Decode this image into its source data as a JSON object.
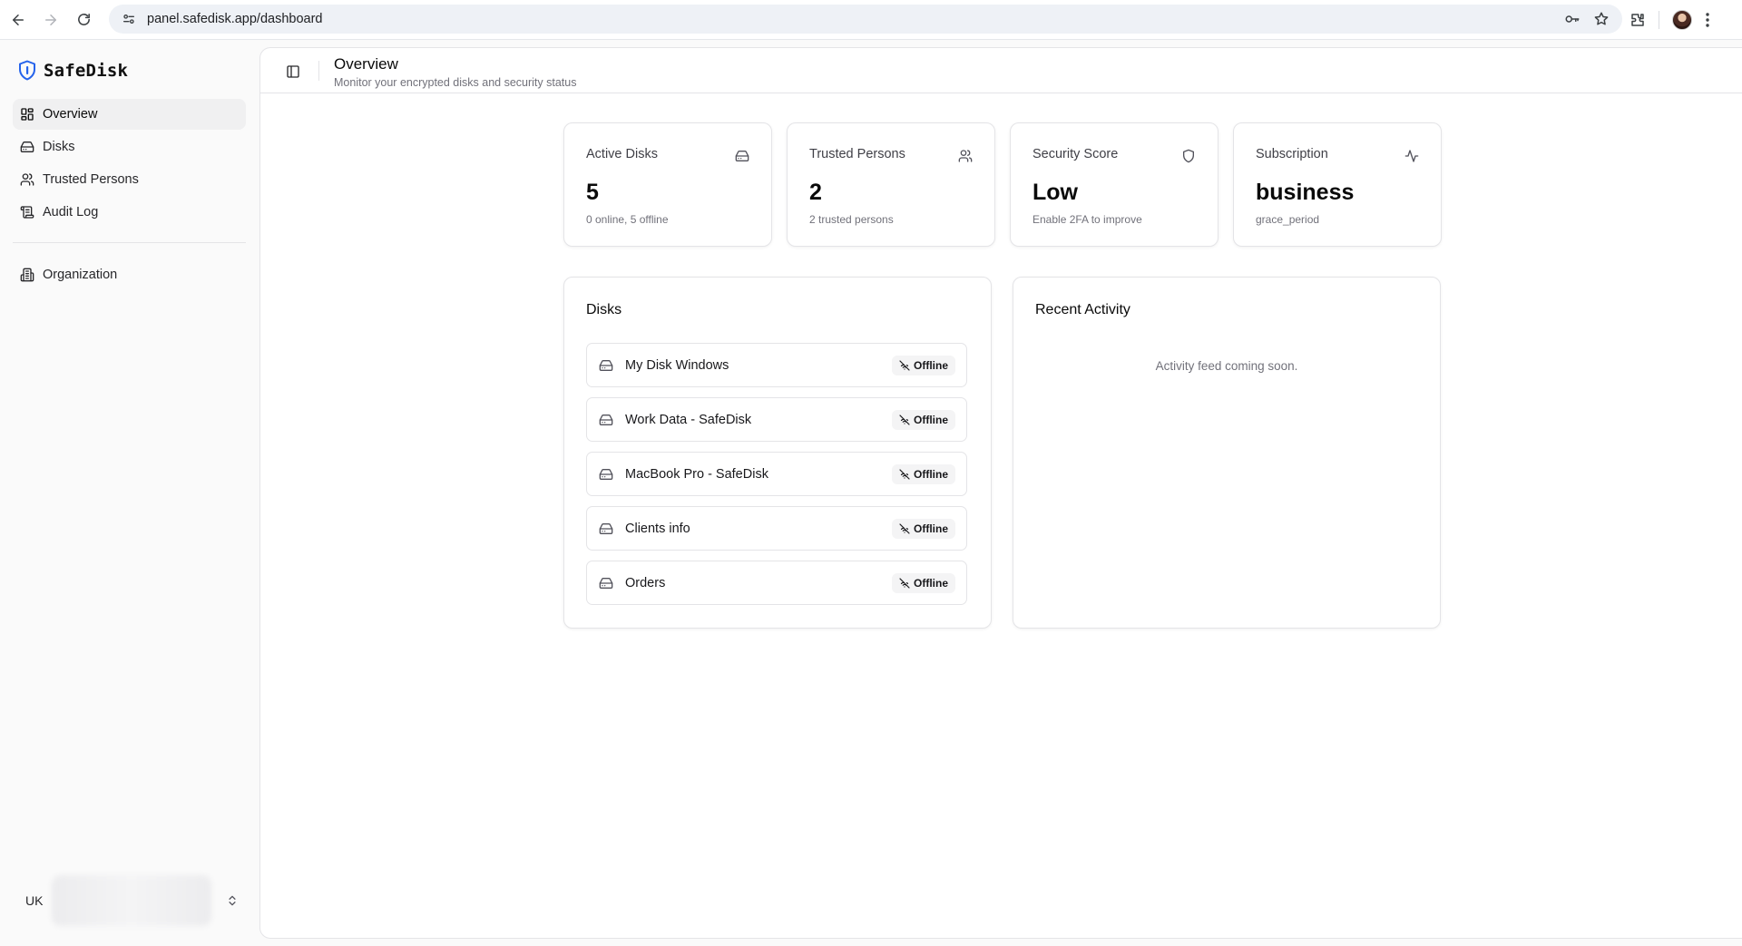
{
  "browser": {
    "url": "panel.safedisk.app/dashboard"
  },
  "sidebar": {
    "brand": "SafeDisk",
    "items": [
      {
        "label": "Overview",
        "icon": "layout-grid-icon",
        "active": true
      },
      {
        "label": "Disks",
        "icon": "hard-drive-icon"
      },
      {
        "label": "Trusted Persons",
        "icon": "users-icon"
      },
      {
        "label": "Audit Log",
        "icon": "scroll-text-icon"
      }
    ],
    "secondary_items": [
      {
        "label": "Organization",
        "icon": "building-icon"
      }
    ],
    "org_switcher": {
      "code": "UK"
    }
  },
  "header": {
    "title": "Overview",
    "subtitle": "Monitor your encrypted disks and security status"
  },
  "stats": [
    {
      "label": "Active Disks",
      "value": "5",
      "sub": "0 online, 5 offline",
      "icon": "hard-drive-icon"
    },
    {
      "label": "Trusted Persons",
      "value": "2",
      "sub": "2 trusted persons",
      "icon": "users-icon"
    },
    {
      "label": "Security Score",
      "value": "Low",
      "sub": "Enable 2FA to improve",
      "icon": "shield-icon"
    },
    {
      "label": "Subscription",
      "value": "business",
      "sub": "grace_period",
      "icon": "activity-icon"
    }
  ],
  "disks_panel": {
    "title": "Disks",
    "items": [
      {
        "name": "My Disk Windows",
        "status": "Offline"
      },
      {
        "name": "Work Data - SafeDisk",
        "status": "Offline"
      },
      {
        "name": "MacBook Pro - SafeDisk",
        "status": "Offline"
      },
      {
        "name": "Clients info",
        "status": "Offline"
      },
      {
        "name": "Orders",
        "status": "Offline"
      }
    ]
  },
  "activity_panel": {
    "title": "Recent Activity",
    "empty_text": "Activity feed coming soon."
  },
  "colors": {
    "brand_shield": "#2563eb",
    "border": "#e4e4e7",
    "muted_text": "#71717a"
  }
}
